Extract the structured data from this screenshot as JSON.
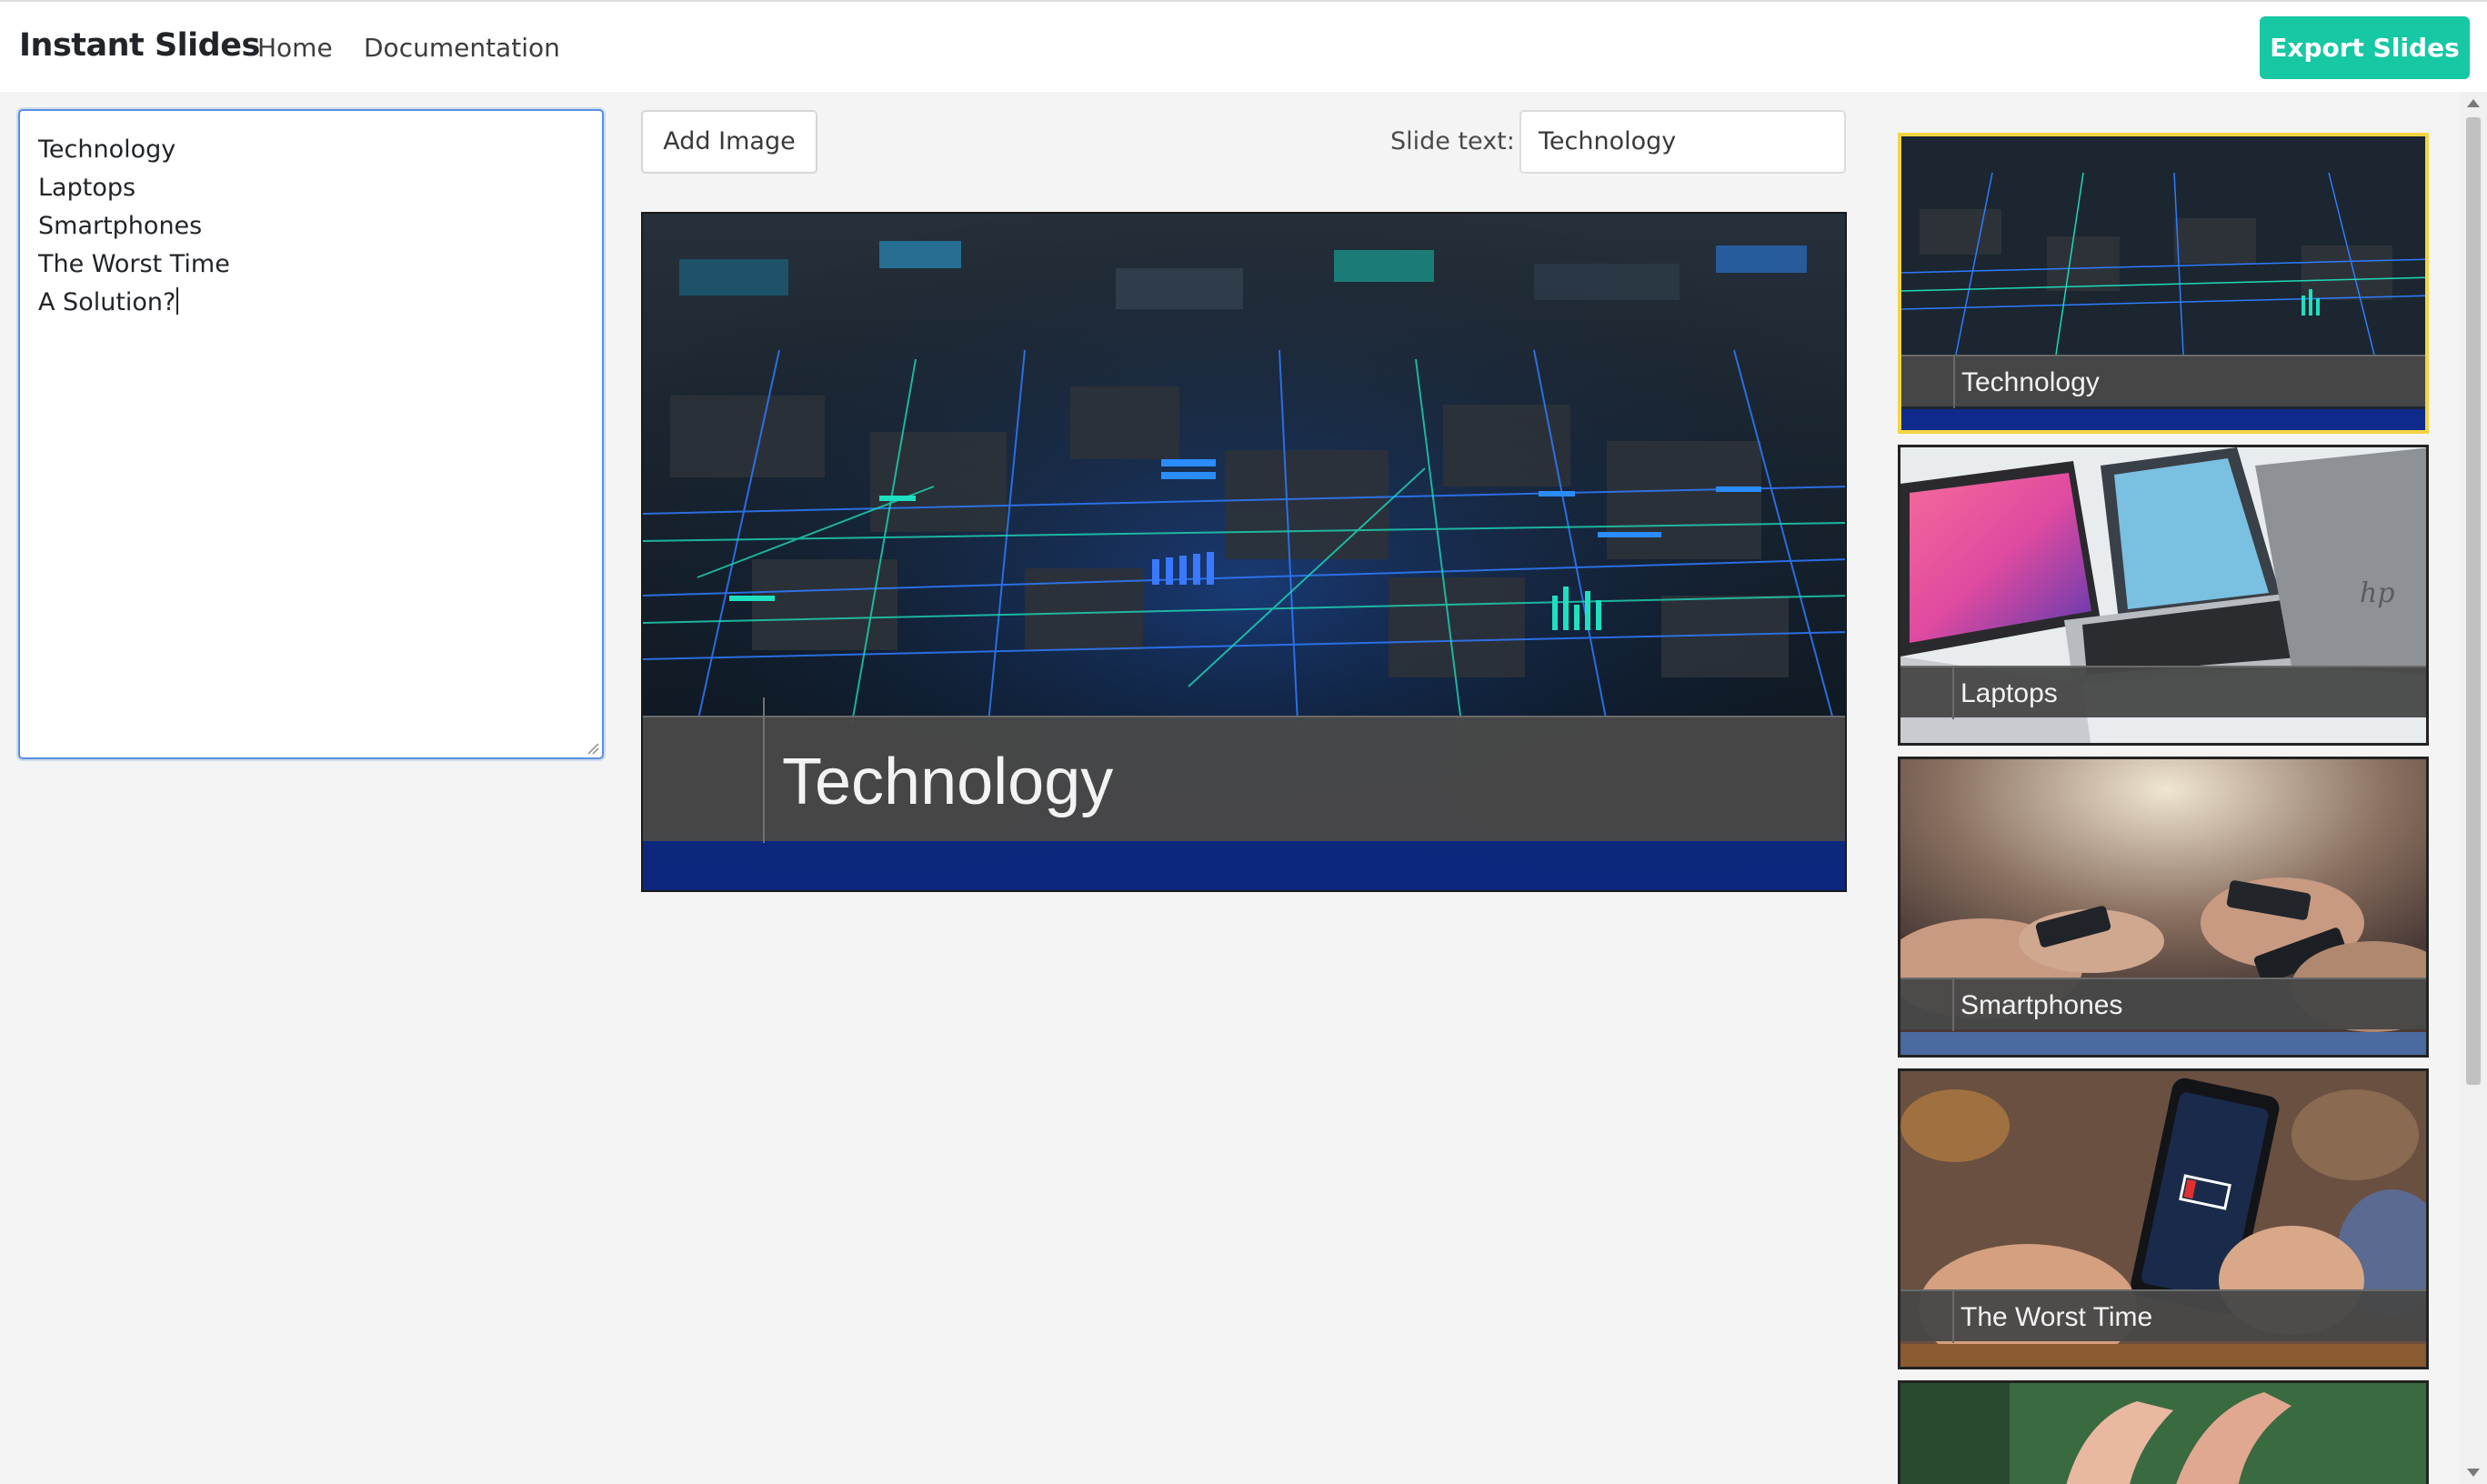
{
  "app": {
    "brand": "Instant Slides",
    "nav": {
      "home": "Home",
      "documentation": "Documentation"
    },
    "export_label": "Export Slides",
    "accent_color": "#17c8a4"
  },
  "outline": {
    "lines": [
      "Technology",
      "Laptops",
      "Smartphones",
      "The Worst Time",
      "A Solution?"
    ]
  },
  "toolbar": {
    "add_image_label": "Add Image",
    "slide_text_label": "Slide text:",
    "slide_text_value": "Technology"
  },
  "main_slide": {
    "caption": "Technology",
    "image": "circuit-board-image"
  },
  "thumbnails": [
    {
      "caption": "Technology",
      "image": "circuit-board-image",
      "selected": true
    },
    {
      "caption": "Laptops",
      "image": "laptops-image",
      "selected": false
    },
    {
      "caption": "Smartphones",
      "image": "smartphones-image",
      "selected": false
    },
    {
      "caption": "The Worst Time",
      "image": "low-battery-phone-image",
      "selected": false
    },
    {
      "caption": "",
      "image": "hand-image",
      "selected": false
    }
  ]
}
